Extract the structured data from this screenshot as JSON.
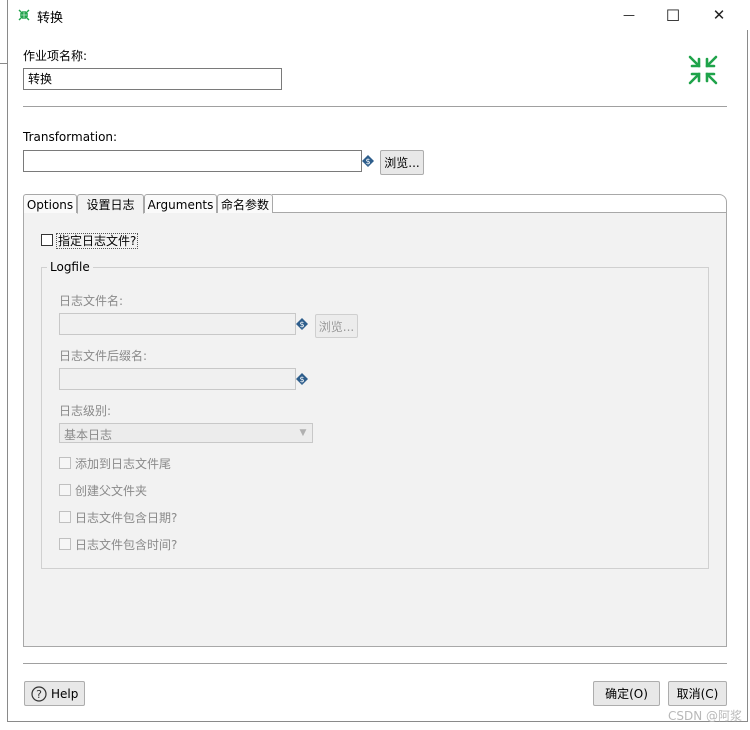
{
  "window": {
    "title": "转换",
    "minimize_glyph": "—",
    "maximize_glyph": "☐",
    "close_glyph": "✕"
  },
  "job_entry": {
    "name_label": "作业项名称:",
    "name_value": "转换"
  },
  "transformation": {
    "label": "Transformation:",
    "value": "",
    "browse_label": "浏览..."
  },
  "tabs": [
    {
      "label": "Options",
      "active": false
    },
    {
      "label": "设置日志",
      "active": true
    },
    {
      "label": "Arguments",
      "active": false
    },
    {
      "label": "命名参数",
      "active": false
    }
  ],
  "logging": {
    "specify_logfile_label": "指定日志文件?",
    "specify_logfile_checked": false,
    "group_title": "Logfile",
    "logfile_name_label": "日志文件名:",
    "logfile_name_value": "",
    "logfile_browse_label": "浏览...",
    "logfile_ext_label": "日志文件后缀名:",
    "logfile_ext_value": "",
    "log_level_label": "日志级别:",
    "log_level_value": "基本日志",
    "append_label": "添加到日志文件尾",
    "create_parent_label": "创建父文件夹",
    "include_date_label": "日志文件包含日期?",
    "include_time_label": "日志文件包含时间?"
  },
  "footer": {
    "help_label": "Help",
    "ok_label": "确定(O)",
    "cancel_label": "取消(C)"
  },
  "watermark": "CSDN @阿浆",
  "colors": {
    "accent_green": "#1fa34a",
    "variable_icon": "#2e5e8c",
    "tab_panel_bg": "#f2f2f2"
  },
  "icons": {
    "title": "transform-arrows-icon",
    "header": "transform-arrows-icon",
    "variable": "variable-dollar-icon",
    "help": "question-circle-icon"
  }
}
